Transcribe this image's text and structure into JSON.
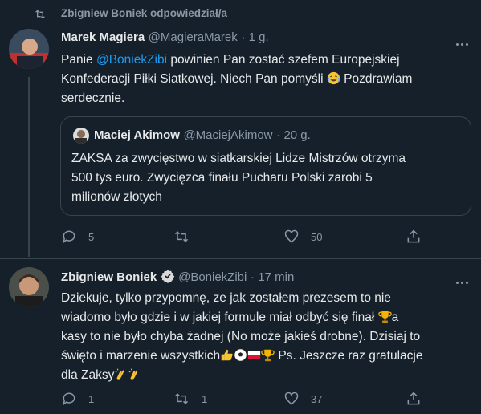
{
  "context": {
    "text": "Zbigniew Boniek odpowiedział/a"
  },
  "tweet1": {
    "name": "Marek Magiera",
    "handle": "@MagieraMarek",
    "sep": "·",
    "time": "1 g.",
    "text_pre": "Panie ",
    "mention": "@BoniekZibi",
    "text_mid": " powinien Pan zostać szefem Europejskiej",
    "line2": "Konfederacji Piłki Siatkowej. Niech Pan pomyśli ",
    "line2_after": " Pozdrawiam",
    "line3": "serdecznie.",
    "replies": "5",
    "retweets": "",
    "likes": "50"
  },
  "quote": {
    "name": "Maciej Akimow",
    "handle": "@MaciejAkimow",
    "sep": "·",
    "time": "20 g.",
    "line1": "ZAKSA za zwycięstwo w siatkarskiej Lidze Mistrzów otrzyma",
    "line2": "500 tys euro. Zwycięzca finału Pucharu Polski zarobi 5",
    "line3": "milionów złotych"
  },
  "tweet2": {
    "name": "Zbigniew Boniek",
    "handle": "@BoniekZibi",
    "sep": "·",
    "time": "17 min",
    "line1": "Dziekuje, tylko przypomnę, ze jak zostałem prezesem to nie",
    "line2a": "wiadomo było gdzie i w jakiej formule miał odbyć się finał ",
    "line2b": "a",
    "line3": "kasy to nie było chyba żadnej (No może jakieś drobne). Dzisiaj to",
    "line4a": "święto i marzenie wszystkich",
    "line4b": " Ps. Jeszcze raz gratulacje",
    "line5": "dla Zaksy",
    "replies": "1",
    "retweets": "1",
    "likes": "37"
  },
  "colors": {
    "background": "#15202b",
    "text": "#e7e9ea",
    "muted": "#8b98a5",
    "link": "#1d9bf0",
    "border": "#38444d",
    "verified": "#d9d9d9"
  },
  "icons": [
    "retweet-icon",
    "more-icon",
    "reply-icon",
    "retweet-icon",
    "like-icon",
    "share-icon",
    "verified-icon",
    "emoji-laugh-cry",
    "emoji-trophy",
    "emoji-thumbs-up",
    "emoji-soccer-ball",
    "emoji-flag-poland",
    "emoji-clapping"
  ]
}
